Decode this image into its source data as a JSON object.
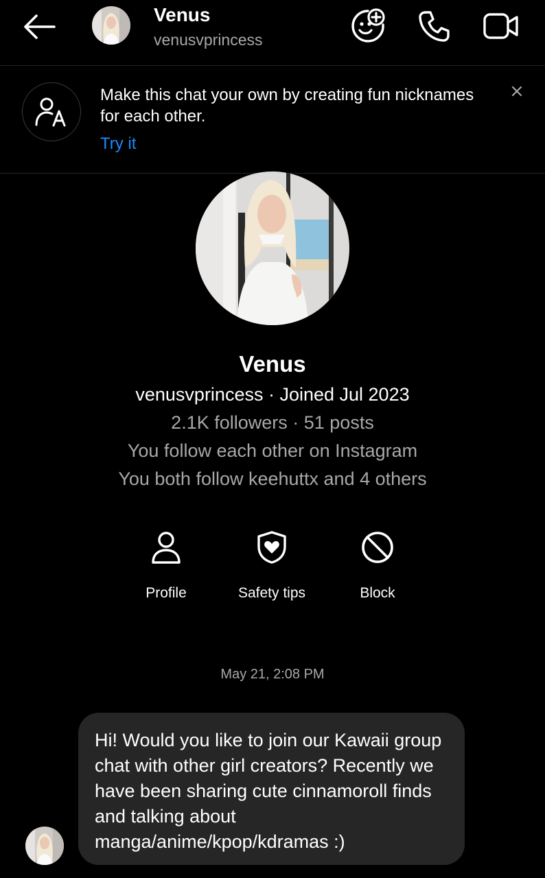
{
  "header": {
    "name": "Venus",
    "username": "venusvprincess",
    "icons": [
      "back-arrow-icon",
      "avatar",
      "add-sticker-icon",
      "phone-icon",
      "video-icon"
    ]
  },
  "banner": {
    "text": "Make this chat your own by creating fun nicknames for each other.",
    "link": "Try it",
    "icon": "nickname-icon",
    "link_color": "#1b8cff"
  },
  "profile": {
    "name": "Venus",
    "meta": "venusvprincess · Joined Jul 2023",
    "stats": "2.1K followers · 51 posts",
    "follow_status": "You follow each other on Instagram",
    "mutual": "You both follow keehuttx and 4 others"
  },
  "actions": [
    {
      "label": "Profile",
      "icon": "person-icon"
    },
    {
      "label": "Safety tips",
      "icon": "shield-heart-icon"
    },
    {
      "label": "Block",
      "icon": "block-icon"
    }
  ],
  "conversation": {
    "timestamp": "May 21, 2:08 PM",
    "messages": [
      {
        "from": "Venus",
        "text": "Hi! Would you like to join our Kawaii group chat with other girl creators? Recently we have been sharing cute cinnamoroll finds and talking about manga/anime/kpop/kdramas :)"
      }
    ]
  },
  "colors": {
    "background": "#000000",
    "bubble": "#262626",
    "secondary_text": "#a8a8a8",
    "divider": "#262626"
  }
}
